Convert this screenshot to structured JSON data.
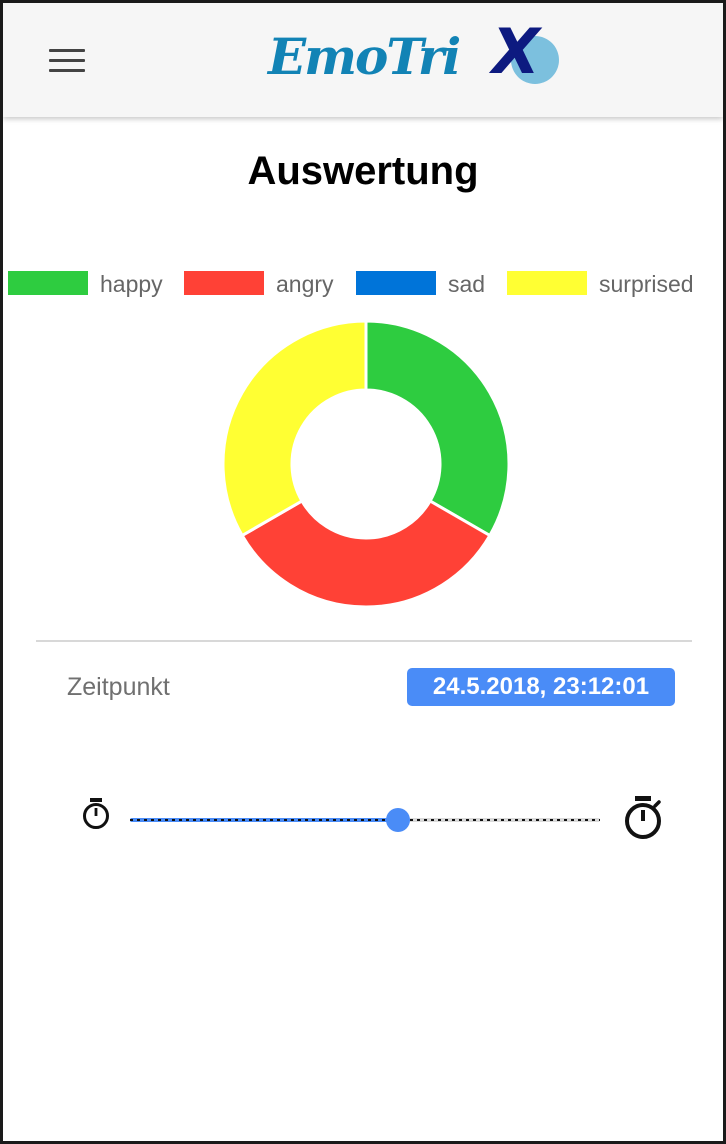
{
  "header": {
    "logo_text": "EmoTri",
    "logo_x": "X",
    "menu_icon": "hamburger-menu-icon"
  },
  "page": {
    "title": "Auswertung"
  },
  "chart_data": {
    "type": "pie",
    "style": "doughnut",
    "categories": [
      "happy",
      "angry",
      "sad",
      "surprised"
    ],
    "values": [
      1,
      1,
      0,
      1
    ],
    "colors": [
      "#2ecc40",
      "#ff4136",
      "#0074d9",
      "#ffff33"
    ],
    "legend": "top",
    "title": ""
  },
  "timestamp": {
    "label": "Zeitpunkt",
    "value": "24.5.2018, 23:12:01"
  },
  "slider": {
    "progress": 0.57,
    "start_icon": "stopwatch-small-icon",
    "end_icon": "stopwatch-large-icon"
  }
}
